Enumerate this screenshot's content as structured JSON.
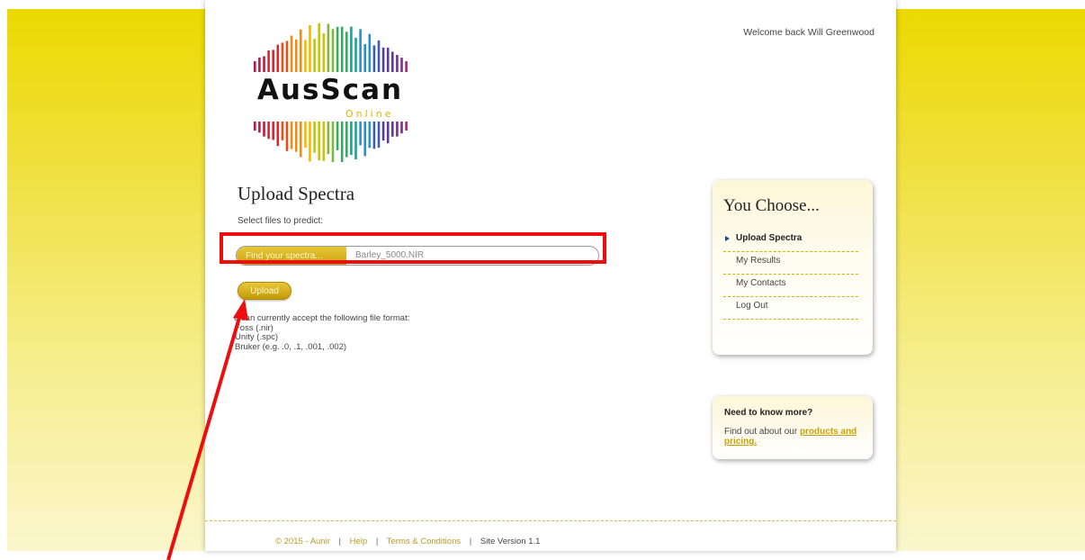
{
  "header": {
    "welcome": "Welcome back Will Greenwood",
    "logo_text": "AusScan",
    "logo_sub": "Online"
  },
  "main": {
    "title": "Upload Spectra",
    "select_label": "Select files to predict:",
    "find_button": "Find your spectra...",
    "file_name": "Barley_5000.NIR",
    "upload_button": "Upload",
    "formats_intro": "e can currently accept the following file format:",
    "formats": [
      "Foss (.nir)",
      "Unity (.spc)",
      "Bruker (e.g. .0, .1, .001, .002)"
    ]
  },
  "sidebar": {
    "title": "You Choose...",
    "items": [
      {
        "label": "Upload Spectra",
        "active": true
      },
      {
        "label": "My Results"
      },
      {
        "label": "My Contacts"
      },
      {
        "label": "Log Out"
      }
    ]
  },
  "info": {
    "title": "Need to know more?",
    "text": "Find out about our ",
    "link": "products and pricing."
  },
  "footer": {
    "copyright": "© 2015 - Aunir",
    "help": "Help",
    "terms": "Terms & Conditions",
    "version": "Site Version 1.1",
    "separator": "|"
  },
  "colors": {
    "accent": "#c9a10c",
    "highlight_box": "#ee0d0d",
    "nav_arrow": "#1a4b8c"
  }
}
